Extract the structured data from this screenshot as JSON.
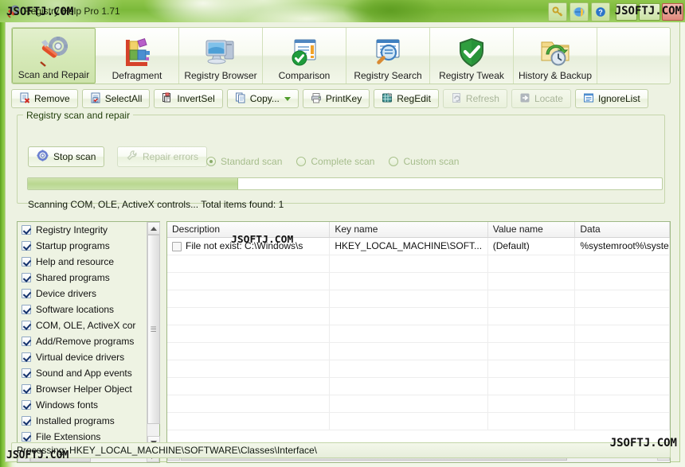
{
  "window": {
    "title": "Registry Help Pro  1.71",
    "app_icon": "wrench-gear-icon",
    "title_buttons": [
      "key-icon",
      "globe-icon",
      "help-icon"
    ],
    "controls": [
      "minimize-button",
      "maximize-button",
      "close-button"
    ]
  },
  "watermarks": {
    "title": "JSOFTJ.COM",
    "top_right": "JSOFTJ.COM",
    "grid": "JSOFTJ.COM",
    "status": "JSOFTJ.COM",
    "bottom_right": "JSOFTJ.COM"
  },
  "ribbon": {
    "selected": 0,
    "items": [
      {
        "label": "Scan and Repair",
        "icon": "wrench-gear-icon"
      },
      {
        "label": "Defragment",
        "icon": "defrag-blocks-icon"
      },
      {
        "label": "Registry Browser",
        "icon": "computer-monitor-icon"
      },
      {
        "label": "Comparison",
        "icon": "document-check-icon"
      },
      {
        "label": "Registry Search",
        "icon": "window-magnifier-icon"
      },
      {
        "label": "Registry Tweak",
        "icon": "shield-check-icon"
      },
      {
        "label": "History & Backup",
        "icon": "folder-clock-icon"
      }
    ]
  },
  "toolbar": {
    "buttons": [
      {
        "label": "Remove",
        "icon": "page-delete-icon",
        "enabled": true,
        "dropdown": false
      },
      {
        "label": "SelectAll",
        "icon": "page-check-icon",
        "enabled": true,
        "dropdown": false
      },
      {
        "label": "InvertSel",
        "icon": "page-invert-icon",
        "enabled": true,
        "dropdown": false
      },
      {
        "label": "Copy...",
        "icon": "copy-pages-icon",
        "enabled": true,
        "dropdown": true
      },
      {
        "label": "PrintKey",
        "icon": "printer-icon",
        "enabled": true,
        "dropdown": false
      },
      {
        "label": "RegEdit",
        "icon": "regedit-icon",
        "enabled": true,
        "dropdown": false
      },
      {
        "label": "Refresh",
        "icon": "refresh-icon",
        "enabled": false,
        "dropdown": false
      },
      {
        "label": "Locate",
        "icon": "arrow-right-icon",
        "enabled": false,
        "dropdown": false
      },
      {
        "label": "IgnoreList",
        "icon": "list-icon",
        "enabled": true,
        "dropdown": false
      }
    ]
  },
  "scan_group": {
    "title": "Registry scan and repair",
    "stop_button": {
      "label": "Stop scan",
      "icon": "gear-spin-icon",
      "enabled": true
    },
    "repair_button": {
      "label": "Repair errors",
      "icon": "wrench-icon",
      "enabled": false
    },
    "scan_modes": [
      {
        "label": "Standard scan",
        "selected": true,
        "enabled": false
      },
      {
        "label": "Complete scan",
        "selected": false,
        "enabled": false
      },
      {
        "label": "Custom scan",
        "selected": false,
        "enabled": false
      }
    ],
    "progress_percent": 33,
    "status_text": "Scanning COM, OLE, ActiveX controls...  Total items found: 1"
  },
  "scan_areas": {
    "items": [
      {
        "label": "Registry Integrity",
        "checked": true
      },
      {
        "label": "Startup programs",
        "checked": true
      },
      {
        "label": "Help and resource",
        "checked": true
      },
      {
        "label": "Shared programs",
        "checked": true
      },
      {
        "label": "Device drivers",
        "checked": true
      },
      {
        "label": "Software locations",
        "checked": true
      },
      {
        "label": "COM, OLE, ActiveX cor",
        "checked": true
      },
      {
        "label": "Add/Remove programs",
        "checked": true
      },
      {
        "label": "Virtual device drivers",
        "checked": true
      },
      {
        "label": "Sound and App events",
        "checked": true
      },
      {
        "label": "Browser Helper Object",
        "checked": true
      },
      {
        "label": "Windows fonts",
        "checked": true
      },
      {
        "label": "Installed programs",
        "checked": true
      },
      {
        "label": "File Extensions",
        "checked": true
      }
    ]
  },
  "results_grid": {
    "columns": [
      "Description",
      "Key name",
      "Value name",
      "Data"
    ],
    "rows": [
      {
        "checked": false,
        "description": "File not exist: C:\\Windows\\s",
        "key_name": "HKEY_LOCAL_MACHINE\\SOFT...",
        "value_name": "(Default)",
        "data": "%systemroot%\\syste"
      }
    ]
  },
  "status_bar": {
    "text": "Processing: HKEY_LOCAL_MACHINE\\SOFTWARE\\Classes\\Interface\\"
  },
  "colors": {
    "frame_green": "#8cc63f",
    "client_bg": "#edf2e2",
    "accent": "#4e9b2a",
    "progress_fill": "#b9d790"
  }
}
